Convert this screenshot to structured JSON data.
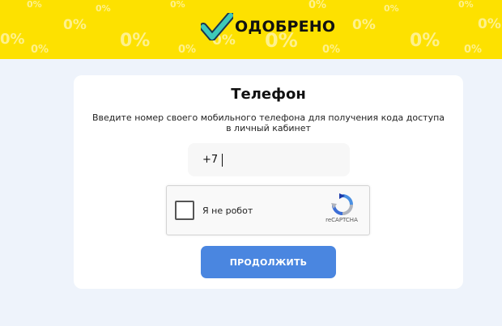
{
  "header": {
    "brand_name": "ОДОБРЕНО",
    "background_color": "#fde100",
    "pattern_text": "0%"
  },
  "form": {
    "title": "Телефон",
    "subtitle": "Введите номер своего мобильного телефона для получения кода доступа в личный кабинет",
    "phone_value": "+7",
    "submit_label": "ПРОДОЛЖИТЬ",
    "accent_color": "#4a86e0"
  },
  "recaptcha": {
    "label": "Я не робот",
    "brand": "reCAPTCHA"
  }
}
